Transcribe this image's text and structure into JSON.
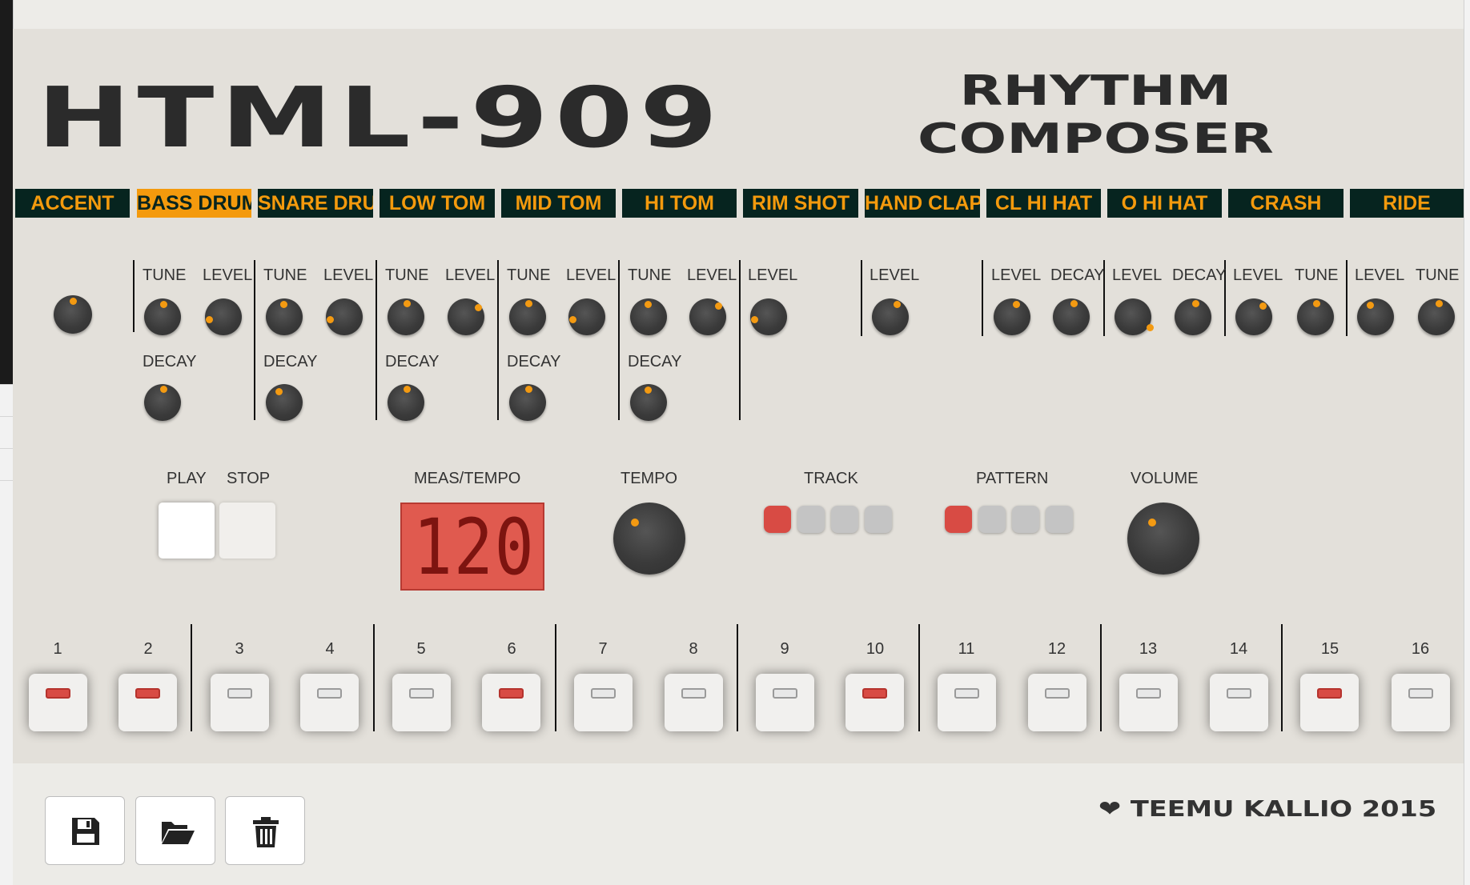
{
  "app": {
    "title": "HTML-909",
    "subtitle_line1": "RHYTHM",
    "subtitle_line2": "COMPOSER"
  },
  "instruments": [
    {
      "name": "ACCENT"
    },
    {
      "name": "BASS DRUM",
      "active": true
    },
    {
      "name": "SNARE DRUM"
    },
    {
      "name": "LOW TOM"
    },
    {
      "name": "MID TOM"
    },
    {
      "name": "HI TOM"
    },
    {
      "name": "RIM SHOT"
    },
    {
      "name": "HAND CLAP"
    },
    {
      "name": "CL HI HAT"
    },
    {
      "name": "O HI HAT"
    },
    {
      "name": "CRASH"
    },
    {
      "name": "RIDE"
    }
  ],
  "knob_labels": {
    "tune": "TUNE",
    "level": "LEVEL",
    "decay": "DECAY"
  },
  "transport": {
    "play_label": "PLAY",
    "stop_label": "STOP"
  },
  "display": {
    "label": "MEAS/TEMPO",
    "value": "120"
  },
  "tempo": {
    "label": "TEMPO"
  },
  "track": {
    "label": "TRACK",
    "count": 4,
    "selected": 1
  },
  "pattern": {
    "label": "PATTERN",
    "count": 4,
    "selected": 1
  },
  "volume": {
    "label": "VOLUME"
  },
  "steps": {
    "labels": [
      "1",
      "2",
      "3",
      "4",
      "5",
      "6",
      "7",
      "8",
      "9",
      "10",
      "11",
      "12",
      "13",
      "14",
      "15",
      "16"
    ],
    "active": [
      true,
      true,
      false,
      false,
      false,
      true,
      false,
      false,
      false,
      true,
      false,
      false,
      false,
      false,
      true,
      false
    ]
  },
  "toolbar": {
    "save_icon": "save-icon",
    "open_icon": "folder-open-icon",
    "delete_icon": "trash-icon"
  },
  "credit": {
    "heart": "❤",
    "text": "TEEMU KALLIO 2015"
  },
  "colors": {
    "accent": "#f49a0d",
    "tab_bg": "#06241f",
    "led_on": "#d84b44",
    "lcd": "#e05a4f"
  }
}
